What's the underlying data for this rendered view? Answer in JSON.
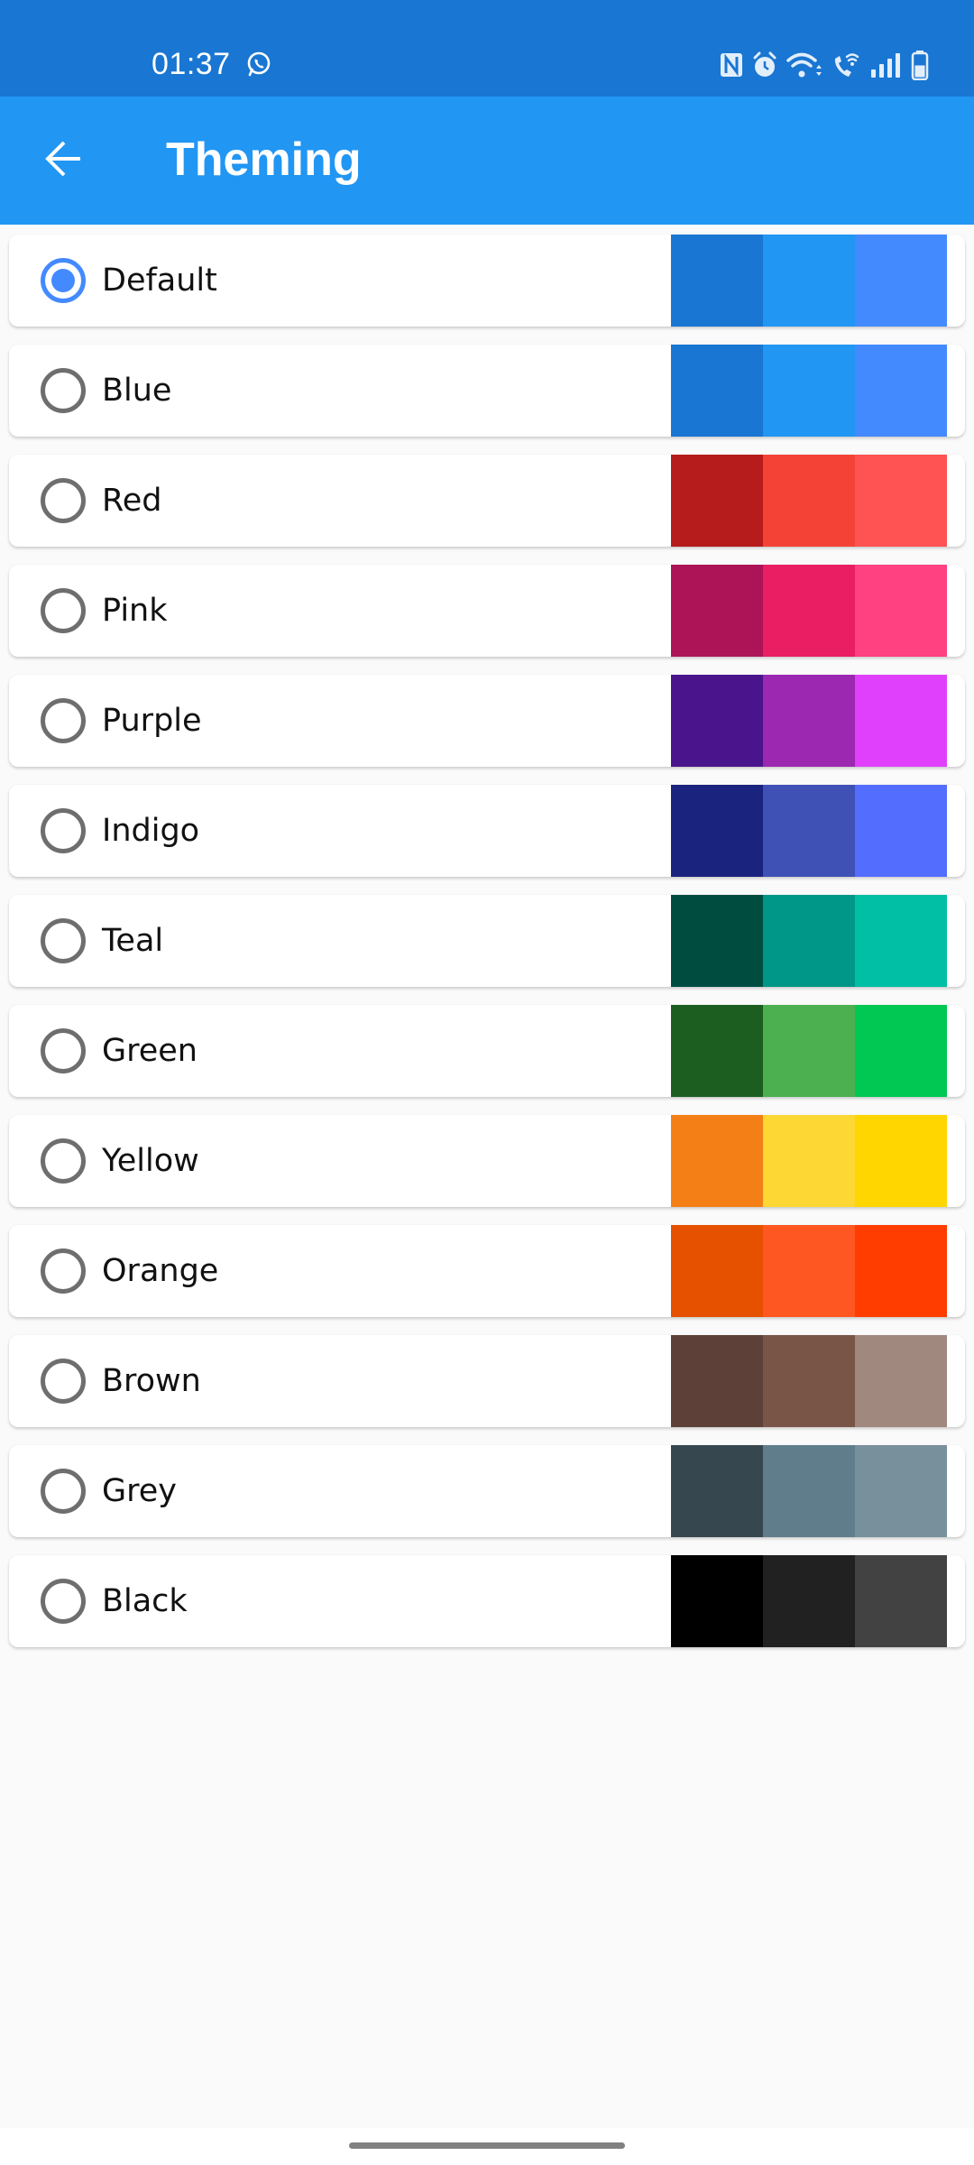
{
  "status_bar": {
    "time": "01:37",
    "notification_icons": [
      "whatsapp-icon"
    ],
    "system_icons": [
      "nfc-icon",
      "alarm-icon",
      "wifi-icon",
      "wifi-calling-icon",
      "signal-icon",
      "battery-icon"
    ],
    "battery_level": 0.5
  },
  "app_bar": {
    "title": "Theming",
    "back_icon": "arrow-back-icon",
    "color": "#2196F3"
  },
  "themes": [
    {
      "label": "Default",
      "selected": true,
      "colors": [
        "#1976D2",
        "#2196F3",
        "#448AFF"
      ]
    },
    {
      "label": "Blue",
      "selected": false,
      "colors": [
        "#1976D2",
        "#2196F3",
        "#448AFF"
      ]
    },
    {
      "label": "Red",
      "selected": false,
      "colors": [
        "#B71C1C",
        "#F44336",
        "#FF5252"
      ]
    },
    {
      "label": "Pink",
      "selected": false,
      "colors": [
        "#AD1457",
        "#E91E63",
        "#FF4081"
      ]
    },
    {
      "label": "Purple",
      "selected": false,
      "colors": [
        "#4A148C",
        "#9C27B0",
        "#E040FB"
      ]
    },
    {
      "label": "Indigo",
      "selected": false,
      "colors": [
        "#1A237E",
        "#3F51B5",
        "#536DFE"
      ]
    },
    {
      "label": "Teal",
      "selected": false,
      "colors": [
        "#004D40",
        "#009688",
        "#00BFA5"
      ]
    },
    {
      "label": "Green",
      "selected": false,
      "colors": [
        "#1B5E20",
        "#4CAF50",
        "#00C853"
      ]
    },
    {
      "label": "Yellow",
      "selected": false,
      "colors": [
        "#F57F17",
        "#FDD835",
        "#FFD600"
      ]
    },
    {
      "label": "Orange",
      "selected": false,
      "colors": [
        "#E65100",
        "#FF5722",
        "#FF3D00"
      ]
    },
    {
      "label": "Brown",
      "selected": false,
      "colors": [
        "#5D4037",
        "#795548",
        "#A1887F"
      ]
    },
    {
      "label": "Grey",
      "selected": false,
      "colors": [
        "#37474F",
        "#607D8B",
        "#78909C"
      ]
    },
    {
      "label": "Black",
      "selected": false,
      "colors": [
        "#000000",
        "#212121",
        "#424242"
      ]
    }
  ],
  "accent_color": "#448AFF"
}
